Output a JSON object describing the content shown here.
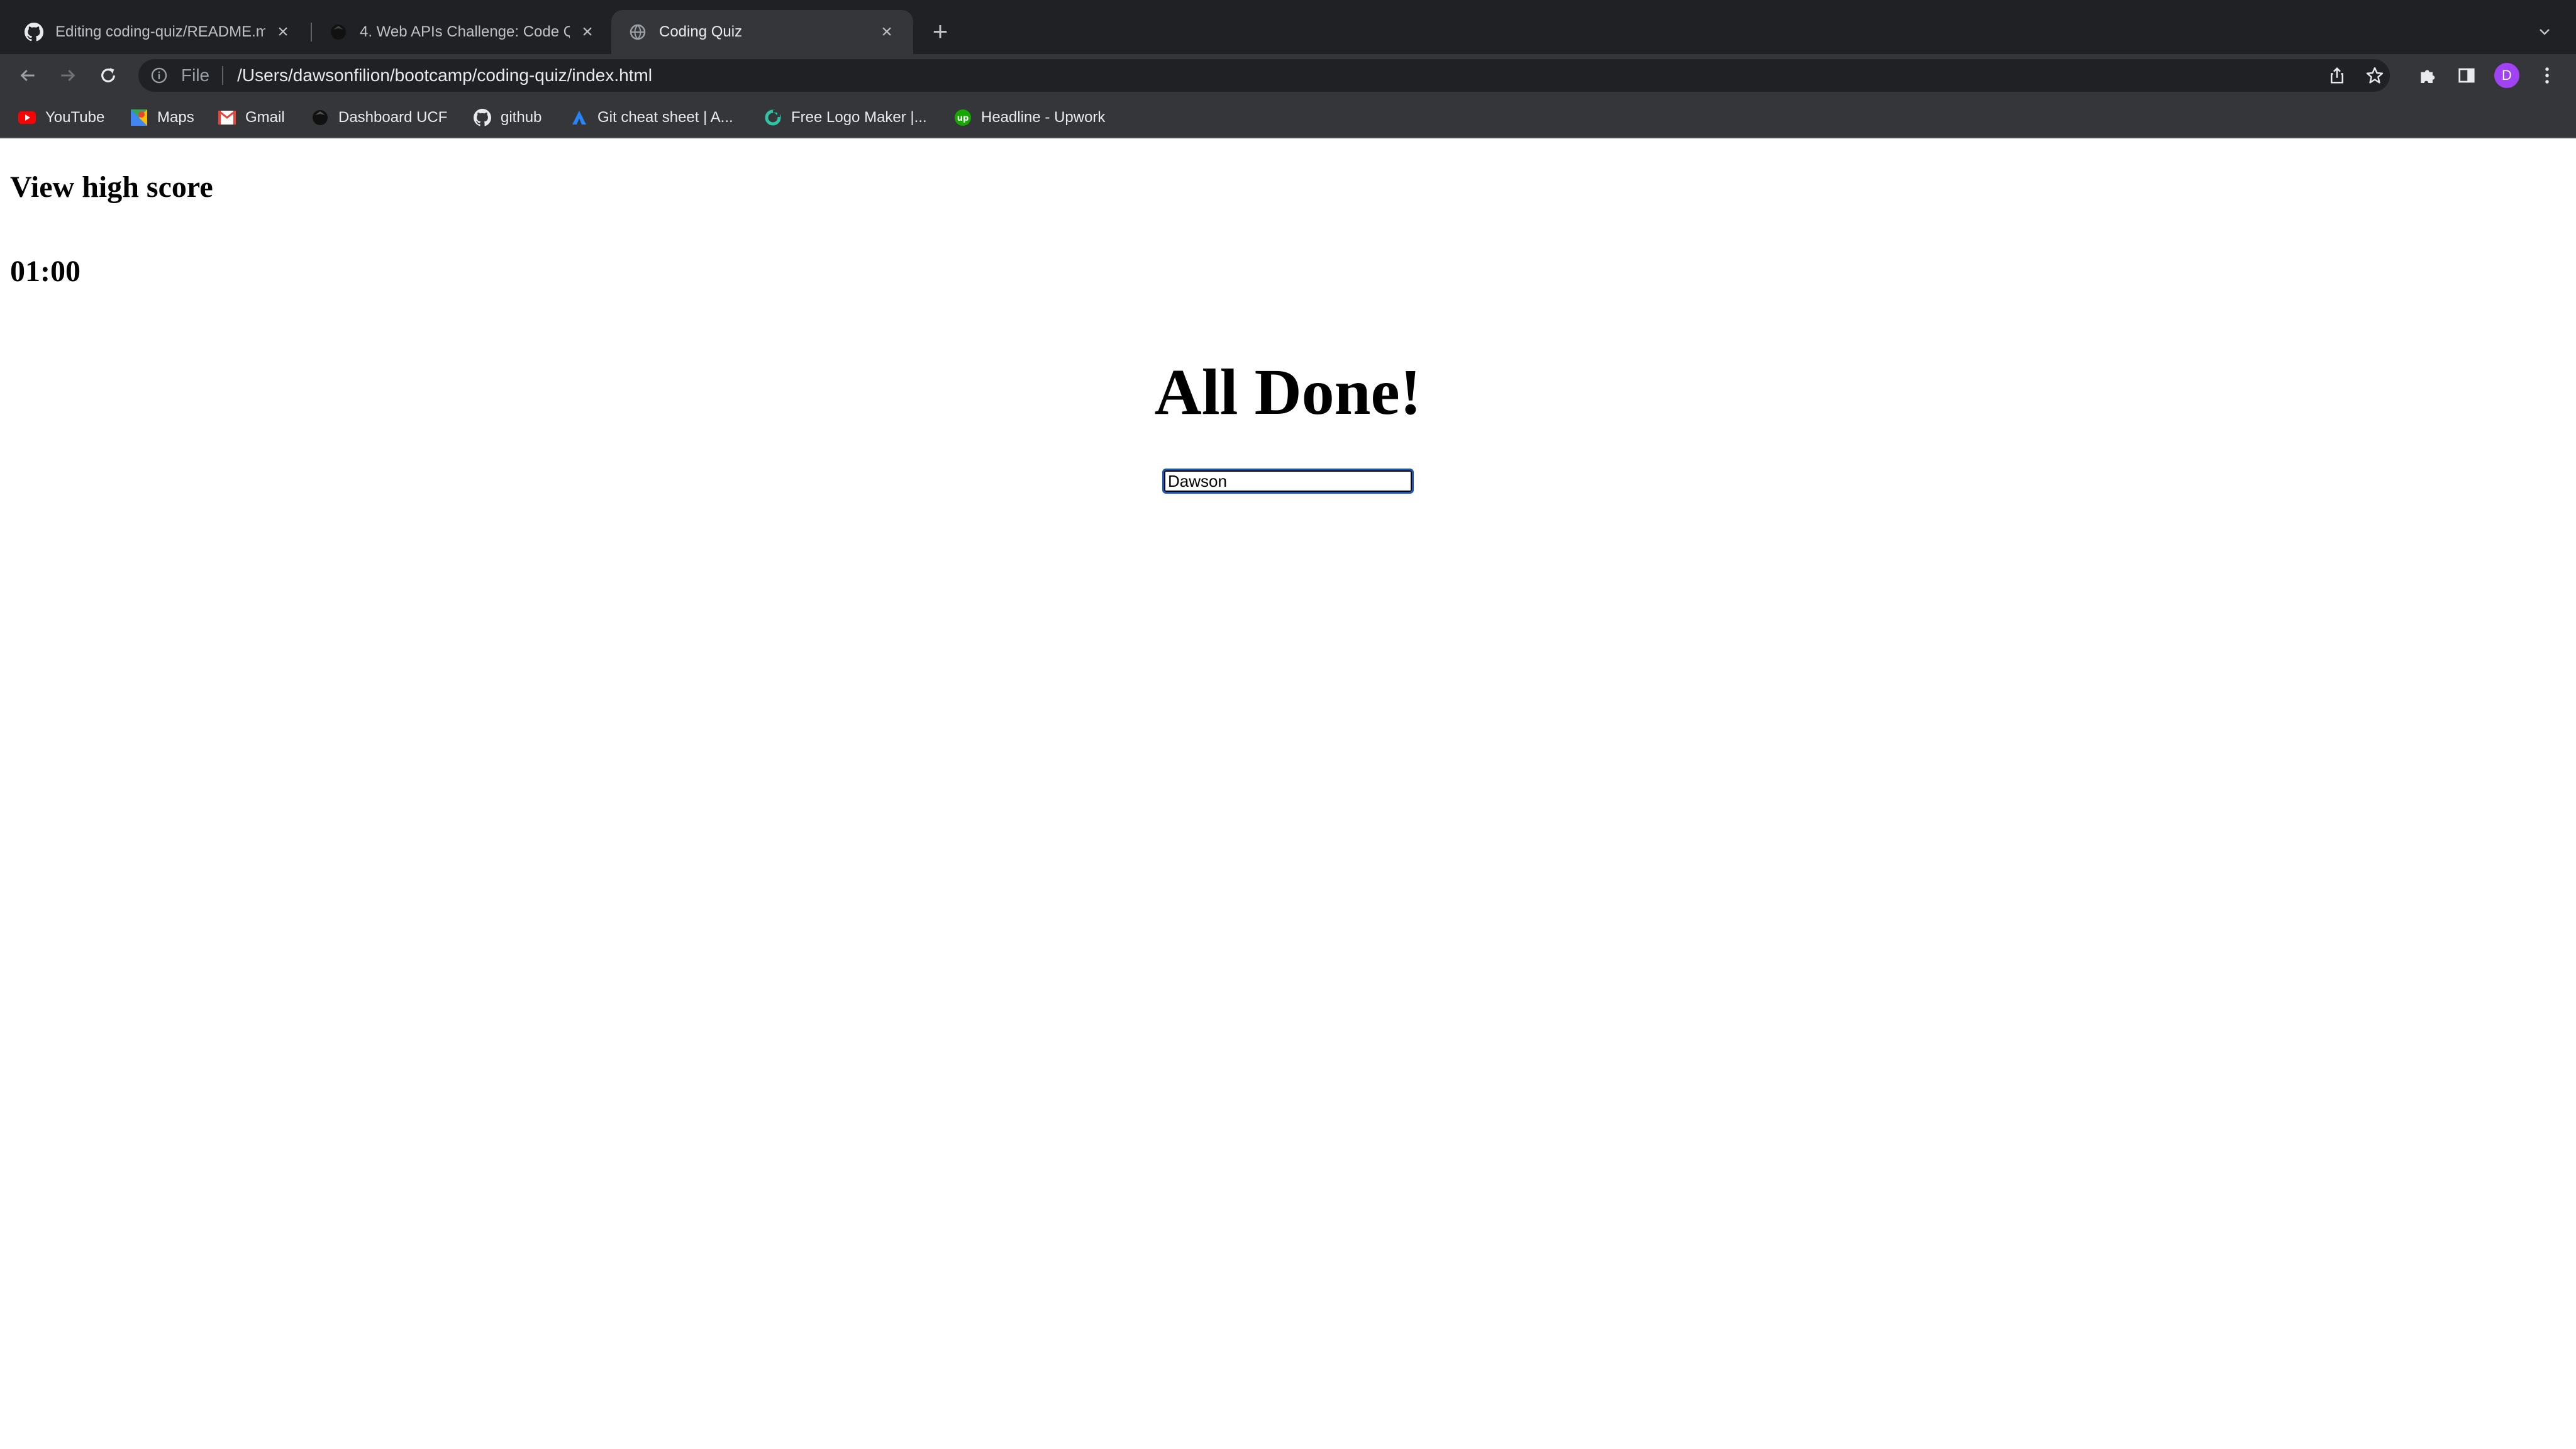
{
  "browser": {
    "tabs": [
      {
        "title": "Editing coding-quiz/README.m",
        "favicon": "github-icon"
      },
      {
        "title": "4. Web APIs Challenge: Code Q",
        "favicon": "bootcamp-icon"
      },
      {
        "title": "Coding Quiz",
        "favicon": "globe-icon",
        "active": true
      }
    ],
    "address": {
      "scheme": "File",
      "url": "/Users/dawsonfilion/bootcamp/coding-quiz/index.html"
    },
    "profile_initial": "D",
    "bookmarks": [
      {
        "label": "YouTube",
        "icon": "youtube-icon"
      },
      {
        "label": "Maps",
        "icon": "maps-icon"
      },
      {
        "label": "Gmail",
        "icon": "gmail-icon"
      },
      {
        "label": "Dashboard UCF",
        "icon": "bootcamp-icon"
      },
      {
        "label": "github",
        "icon": "github-icon"
      },
      {
        "label": "Git cheat sheet | A...",
        "icon": "atlassian-icon"
      },
      {
        "label": "Free Logo Maker |...",
        "icon": "logo-maker-icon"
      },
      {
        "label": "Headline - Upwork",
        "icon": "upwork-icon"
      }
    ],
    "colors": {
      "chrome_dark": "#202124",
      "chrome_toolbar": "#35363a",
      "avatar": "#a142f4"
    }
  },
  "page": {
    "high_score_link": "View high score",
    "timer": "01:00",
    "title": "All Done!",
    "name_input_value": "Dawson"
  }
}
